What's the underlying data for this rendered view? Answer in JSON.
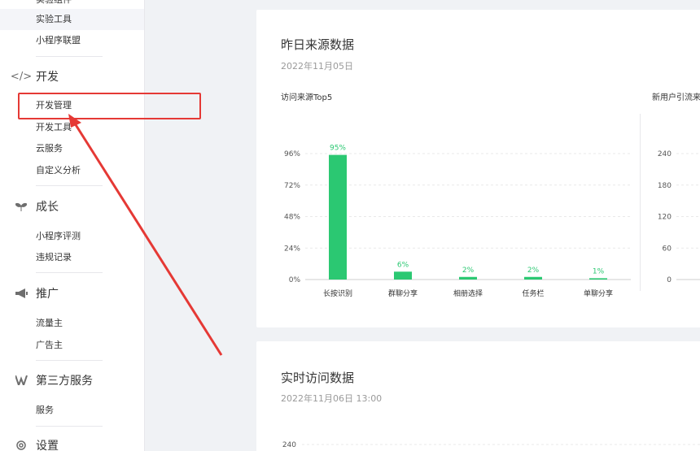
{
  "sidebar": {
    "clipped_top_item": "实验组件",
    "experiment_tools": "实验工具",
    "mini_alliance": "小程序联盟",
    "dev_section": {
      "icon": "code-icon",
      "label": "开发"
    },
    "dev_items": [
      "开发管理",
      "开发工具",
      "云服务",
      "自定义分析"
    ],
    "growth_section": {
      "icon": "sprout-icon",
      "label": "成长"
    },
    "growth_items": [
      "小程序评测",
      "违规记录"
    ],
    "promo_section": {
      "icon": "megaphone-icon",
      "label": "推广"
    },
    "promo_items": [
      "流量主",
      "广告主"
    ],
    "thirdparty_section": {
      "icon": "thirdparty-icon",
      "label": "第三方服务"
    },
    "thirdparty_items": [
      "服务"
    ],
    "settings_section": {
      "icon": "gear-icon",
      "label": "设置"
    }
  },
  "yesterday_card": {
    "title": "昨日来源数据",
    "date": "2022年11月05日",
    "left_chart_title": "访问来源Top5",
    "right_chart_title": "新用户引流来"
  },
  "realtime_card": {
    "title": "实时访问数据",
    "date": "2022年11月06日 13:00"
  },
  "colors": {
    "bar": "#2bc872",
    "annotation": "#e53935"
  },
  "chart_data": [
    {
      "type": "bar",
      "title": "访问来源Top5",
      "categories": [
        "长按识别",
        "群聊分享",
        "相册选择",
        "任务栏",
        "单聊分享"
      ],
      "values": [
        95,
        6,
        2,
        2,
        1
      ],
      "data_labels": [
        "95%",
        "6%",
        "2%",
        "2%",
        "1%"
      ],
      "y_ticks": [
        "0%",
        "24%",
        "48%",
        "72%",
        "96%"
      ],
      "ylim": [
        0,
        96
      ],
      "grid": true
    },
    {
      "type": "bar",
      "title": "新用户引流来",
      "y_ticks": [
        "0",
        "60",
        "120",
        "180",
        "240"
      ],
      "ylim": [
        0,
        240
      ],
      "grid": true
    },
    {
      "type": "line",
      "title": "实时访问数据",
      "y_ticks": [
        "240"
      ],
      "grid": true
    }
  ]
}
